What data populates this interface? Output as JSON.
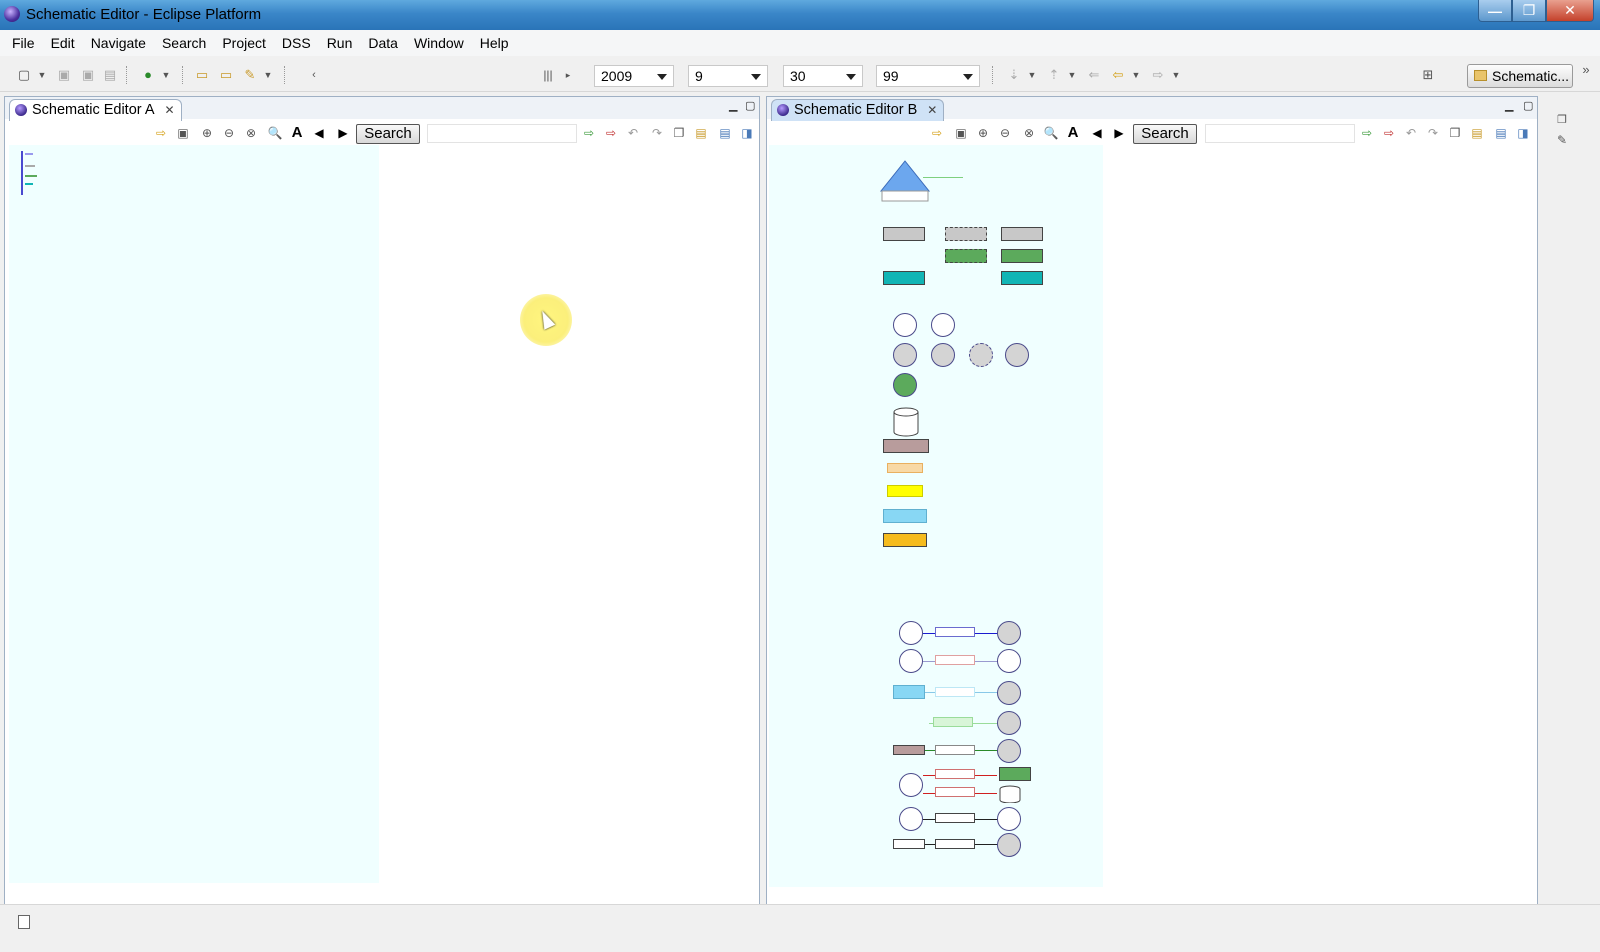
{
  "window": {
    "title": "Schematic Editor - Eclipse Platform",
    "minimize": "—",
    "restore": "❐",
    "close": "✕"
  },
  "menu": [
    "File",
    "Edit",
    "Navigate",
    "Search",
    "Project",
    "DSS",
    "Run",
    "Data",
    "Window",
    "Help"
  ],
  "toolbar": {
    "year": "2009",
    "month": "9",
    "day": "30",
    "percent": "99",
    "perspective_label": "Schematic...",
    "more_chevron": "»"
  },
  "editor_a": {
    "tab_title": "Schematic Editor A",
    "search_label": "Search",
    "search_value": ""
  },
  "editor_b": {
    "tab_title": "Schematic Editor B",
    "search_label": "Search",
    "search_value": ""
  },
  "icons": {
    "new": "new-icon",
    "save": "save-icon",
    "run": "run-icon",
    "open": "open-folder-icon",
    "zoom_in": "zoom-in-icon",
    "zoom_out": "zoom-out-icon",
    "font": "font-icon",
    "prev": "previous-icon",
    "next": "next-icon",
    "undo": "undo-icon",
    "redo": "redo-icon",
    "copy": "copy-icon",
    "paste": "paste-icon",
    "print": "print-icon",
    "back": "back-arrow-icon",
    "forward": "forward-arrow-icon"
  },
  "colors": {
    "canvas": "#f0ffff",
    "shape_grey": "#c8c8c8",
    "shape_green": "#5caa5c",
    "shape_teal": "#11b5b5",
    "shape_rose": "#b89c9c",
    "shape_peach": "#f8d9a6",
    "shape_yellow": "#ffff00",
    "shape_lightblue": "#88d7f4",
    "shape_orange": "#f5bb1d",
    "triangle": "#6ca7ee"
  }
}
